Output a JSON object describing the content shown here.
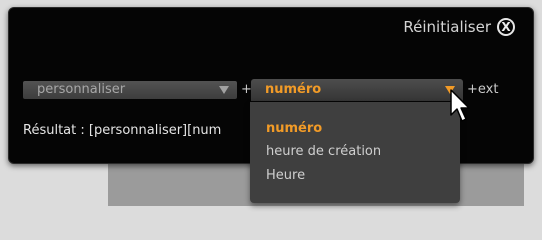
{
  "reset": {
    "label": "Réinitialiser",
    "icon": "close-circle-icon"
  },
  "first_select": {
    "value": "personnaliser"
  },
  "separator_plus": "+",
  "second_select": {
    "value": "numéro",
    "accent_color": "#f29b27"
  },
  "ext_label": "+ext",
  "result_text": "Résultat : [personnaliser][num",
  "dropdown": {
    "options": [
      "numéro",
      "heure de création",
      "Heure"
    ],
    "selected_index": 0
  }
}
